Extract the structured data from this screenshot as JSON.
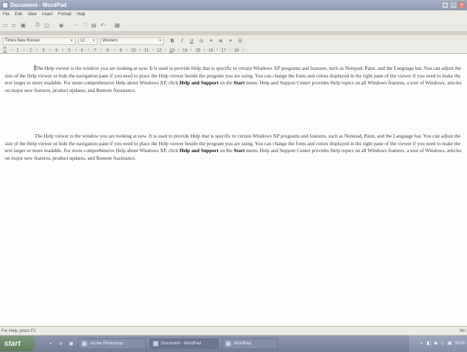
{
  "window": {
    "title": "Document - WordPad"
  },
  "menu": [
    "File",
    "Edit",
    "View",
    "Insert",
    "Format",
    "Help"
  ],
  "toolbar": {
    "icons": [
      "new-icon",
      "open-icon",
      "save-icon",
      "print-icon",
      "print-preview-icon",
      "find-icon",
      "cut-icon",
      "copy-icon",
      "paste-icon",
      "undo-icon",
      "date-time-icon"
    ]
  },
  "format": {
    "font": "Times New Roman",
    "size": "12",
    "script": "Western",
    "bold": "B",
    "italic": "/",
    "underline": "U"
  },
  "ruler": {
    "numbers": [
      "1",
      "2",
      "3",
      "4",
      "5",
      "6",
      "7",
      "8",
      "9",
      "10",
      "11",
      "12",
      "13",
      "14",
      "15",
      "16",
      "17",
      "18"
    ]
  },
  "document": {
    "paragraphs": [
      {
        "t1": "The Help viewer is the window you are looking at now. It is used to provide Help that is specific to certain Windows XP programs and features, such as Notepad, Paint, and the Language bar. You can adjust the size of the Help viewer or hide the navigation pane if you need to place the Help viewer beside the program you are using. You can change the fonts and colors displayed in the right pane of the viewer if you need to make the text larger or more readable. For more comprehensive Help about Windows XP, click ",
        "b1": "Help and Support",
        "t2": " on the ",
        "b2": "Start",
        "t3": " menu. Help and Support Center provides Help topics on all Windows features, a tour of Windows, articles on major new features, product updates, and Remote Assistance."
      },
      {
        "t1": "The Help viewer is the window you are looking at now. It is used to provide Help that is specific to certain Windows XP programs and features, such as Notepad, Paint, and the Language bar. You can adjust the size of the Help viewer or hide the navigation pane if you need to place the Help viewer beside the program you are using. You can change the fonts and colors displayed in the right pane of the viewer if you need to make the text larger or more readable. For more comprehensive Help about Windows XP, click ",
        "b1": "Help and Support",
        "t2": " on the ",
        "b2": "Start",
        "t3": " menu. Help and Support Center provides Help topics on all Windows features, a tour of Windows, articles on major new features, product updates, and Remote Assistance."
      }
    ]
  },
  "status": {
    "text": "For Help, press F1",
    "indicator": "NU"
  },
  "taskbar": {
    "start": "start",
    "tasks": [
      "Adobe Photoshop",
      "Document - WordPad",
      "WordPad"
    ],
    "clock": "06:00"
  },
  "colors": {
    "title_bar": "#a9b3c6",
    "taskbar": "#7d879f",
    "start": "#6f8d6c"
  }
}
